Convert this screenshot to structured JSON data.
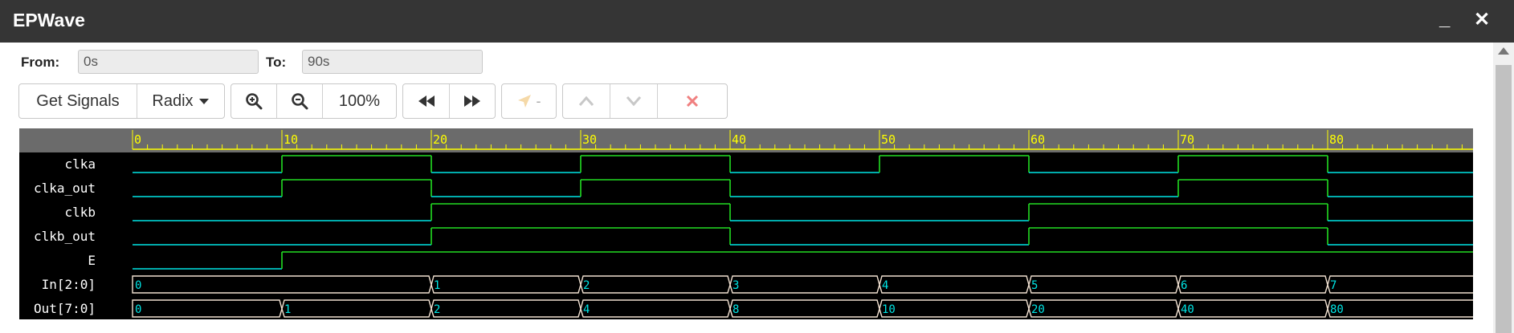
{
  "window": {
    "title": "EPWave",
    "minimize_glyph": "_",
    "close_glyph": "✕"
  },
  "range": {
    "from_label": "From:",
    "from_value": "0s",
    "to_label": "To:",
    "to_value": "90s"
  },
  "toolbar": {
    "get_signals": "Get Signals",
    "radix": "Radix",
    "zoom_level": "100%",
    "cursor_value": "-",
    "icons": [
      "zoom-in-icon",
      "zoom-out-icon",
      "rewind-icon",
      "fast-forward-icon",
      "cursor-arrow-icon",
      "chevron-up-icon",
      "chevron-down-icon",
      "close-icon"
    ]
  },
  "colors": {
    "ruler_bg": "#6b6b6b",
    "ruler_text": "#ffff00",
    "wave_low": "#00e5e5",
    "wave_high": "#22dd22",
    "bus_line": "#f0e0d0",
    "bus_text": "#00e5e5",
    "name_text": "#ffffff"
  },
  "timeline": {
    "ticks": [
      "0",
      "10",
      "20",
      "30",
      "40",
      "50",
      "60",
      "70",
      "80"
    ]
  },
  "signals": [
    {
      "name": "clka",
      "type": "bit",
      "transitions": [
        [
          0,
          0
        ],
        [
          10,
          1
        ],
        [
          20,
          0
        ],
        [
          30,
          1
        ],
        [
          40,
          0
        ],
        [
          50,
          1
        ],
        [
          60,
          0
        ],
        [
          70,
          1
        ],
        [
          80,
          0
        ]
      ]
    },
    {
      "name": "clka_out",
      "type": "bit",
      "transitions": [
        [
          0,
          0
        ],
        [
          10,
          1
        ],
        [
          20,
          0
        ],
        [
          30,
          1
        ],
        [
          40,
          0
        ],
        [
          50,
          0
        ],
        [
          60,
          0
        ],
        [
          70,
          1
        ],
        [
          80,
          0
        ]
      ]
    },
    {
      "name": "clkb",
      "type": "bit",
      "transitions": [
        [
          0,
          0
        ],
        [
          20,
          1
        ],
        [
          40,
          0
        ],
        [
          60,
          1
        ],
        [
          80,
          0
        ]
      ]
    },
    {
      "name": "clkb_out",
      "type": "bit",
      "transitions": [
        [
          0,
          0
        ],
        [
          20,
          1
        ],
        [
          40,
          0
        ],
        [
          60,
          1
        ],
        [
          80,
          0
        ]
      ]
    },
    {
      "name": "E",
      "type": "bit",
      "transitions": [
        [
          0,
          0
        ],
        [
          10,
          1
        ]
      ]
    },
    {
      "name": "In[2:0]",
      "type": "bus",
      "transitions": [
        [
          0,
          "0"
        ],
        [
          20,
          "1"
        ],
        [
          30,
          "2"
        ],
        [
          40,
          "3"
        ],
        [
          50,
          "4"
        ],
        [
          60,
          "5"
        ],
        [
          70,
          "6"
        ],
        [
          80,
          "7"
        ]
      ]
    },
    {
      "name": "Out[7:0]",
      "type": "bus",
      "transitions": [
        [
          0,
          "0"
        ],
        [
          10,
          "1"
        ],
        [
          20,
          "2"
        ],
        [
          30,
          "4"
        ],
        [
          40,
          "8"
        ],
        [
          50,
          "10"
        ],
        [
          60,
          "20"
        ],
        [
          70,
          "40"
        ],
        [
          80,
          "80"
        ]
      ]
    }
  ]
}
